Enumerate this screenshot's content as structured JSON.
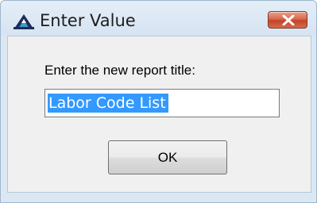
{
  "window": {
    "title": "Enter Value",
    "app_icon": "mountain-logo-icon",
    "close_icon": "close-icon",
    "close_button_color": "#c9462c"
  },
  "dialog": {
    "prompt": "Enter the new report title:",
    "input_value": "Labor Code List",
    "selection_color": "#3399ff",
    "ok_label": "OK"
  }
}
